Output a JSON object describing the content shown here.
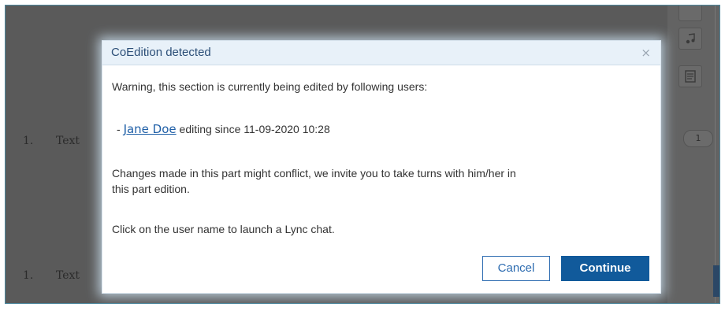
{
  "document": {
    "lines": [
      {
        "number": "1.",
        "text": "Text"
      },
      {
        "number": "1.",
        "text": "Text"
      }
    ]
  },
  "side_panel": {
    "badge": "1",
    "icons": [
      "music-note-icon",
      "document-icon"
    ]
  },
  "dialog": {
    "title": "CoEdition detected",
    "close_glyph": "×",
    "warning": "Warning, this section is currently being edited by following users:",
    "user": {
      "prefix": "- ",
      "name": "Jane Doe",
      "suffix": " editing since 11-09-2020 10:28"
    },
    "conflict_line1": "Changes made in this part might conflict, we invite you to take turns with him/her in",
    "conflict_line2": "this part edition.",
    "hint": "Click on the user name to launch a Lync chat.",
    "cancel_label": "Cancel",
    "continue_label": "Continue"
  },
  "colors": {
    "accent": "#115a9b",
    "link": "#1f5fa7",
    "header_bg": "#e8f1f9"
  }
}
